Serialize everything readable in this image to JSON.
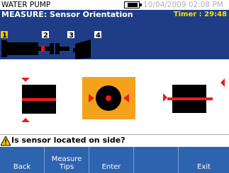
{
  "topbar": {
    "app_title": "WATER PUMP",
    "datetime": "10/04/2009 02:08 PM"
  },
  "header": {
    "title": "MEASURE: Sensor Orientation",
    "timer": "Timer : 29:48"
  },
  "steps": [
    "1",
    "2",
    "3",
    "4"
  ],
  "prompt": "Is sensor located on side?",
  "softkeys": [
    "Back",
    "Measure Tips",
    "Enter",
    "",
    "Exit"
  ],
  "colors": {
    "header_bg": "#1f3d86",
    "timer": "#f7e200",
    "selection": "#f4a21c",
    "arrow": "#ef1b1b",
    "softkey_bg": "#2e63b0"
  }
}
